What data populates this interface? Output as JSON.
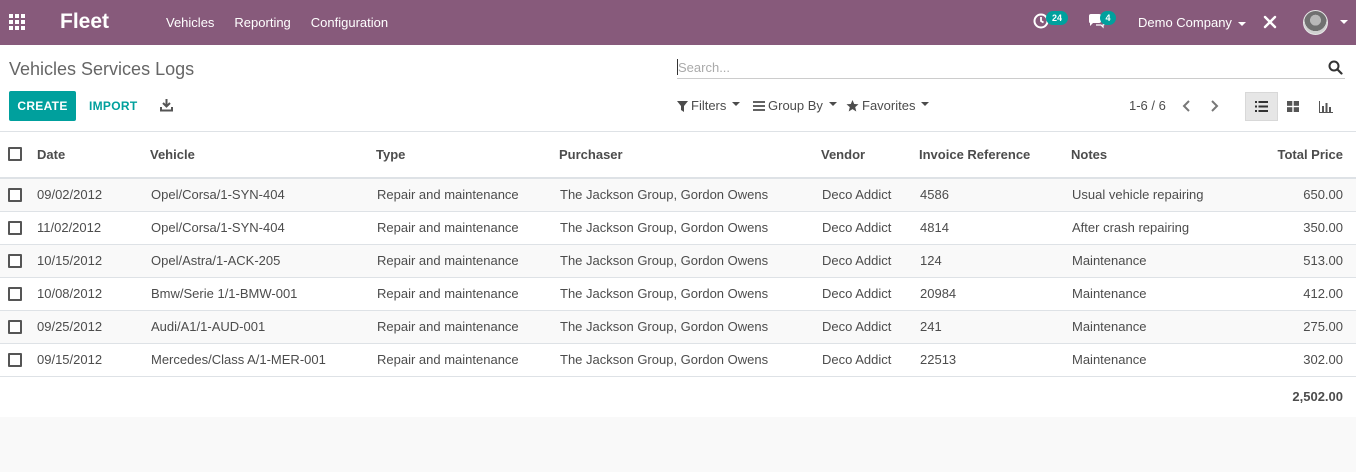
{
  "navbar": {
    "brand": "Fleet",
    "menu": [
      "Vehicles",
      "Reporting",
      "Configuration"
    ],
    "activity_count": "24",
    "chat_count": "4",
    "company": "Demo Company"
  },
  "control": {
    "title": "Vehicles Services Logs",
    "search_placeholder": "Search...",
    "create_label": "CREATE",
    "import_label": "IMPORT",
    "filters_label": "Filters",
    "groupby_label": "Group By",
    "favorites_label": "Favorites",
    "pager": "1-6 / 6"
  },
  "colors": {
    "navbar": "#875a7b",
    "accent": "#00a09d"
  },
  "table": {
    "headers": [
      "Date",
      "Vehicle",
      "Type",
      "Purchaser",
      "Vendor",
      "Invoice Reference",
      "Notes",
      "Total Price"
    ],
    "rows": [
      {
        "date": "09/02/2012",
        "vehicle": "Opel/Corsa/1-SYN-404",
        "type": "Repair and maintenance",
        "purchaser": "The Jackson Group, Gordon Owens",
        "vendor": "Deco Addict",
        "invoice": "4586",
        "notes": "Usual vehicle repairing",
        "total": "650.00"
      },
      {
        "date": "11/02/2012",
        "vehicle": "Opel/Corsa/1-SYN-404",
        "type": "Repair and maintenance",
        "purchaser": "The Jackson Group, Gordon Owens",
        "vendor": "Deco Addict",
        "invoice": "4814",
        "notes": "After crash repairing",
        "total": "350.00"
      },
      {
        "date": "10/15/2012",
        "vehicle": "Opel/Astra/1-ACK-205",
        "type": "Repair and maintenance",
        "purchaser": "The Jackson Group, Gordon Owens",
        "vendor": "Deco Addict",
        "invoice": "124",
        "notes": "Maintenance",
        "total": "513.00"
      },
      {
        "date": "10/08/2012",
        "vehicle": "Bmw/Serie 1/1-BMW-001",
        "type": "Repair and maintenance",
        "purchaser": "The Jackson Group, Gordon Owens",
        "vendor": "Deco Addict",
        "invoice": "20984",
        "notes": "Maintenance",
        "total": "412.00"
      },
      {
        "date": "09/25/2012",
        "vehicle": "Audi/A1/1-AUD-001",
        "type": "Repair and maintenance",
        "purchaser": "The Jackson Group, Gordon Owens",
        "vendor": "Deco Addict",
        "invoice": "241",
        "notes": "Maintenance",
        "total": "275.00"
      },
      {
        "date": "09/15/2012",
        "vehicle": "Mercedes/Class A/1-MER-001",
        "type": "Repair and maintenance",
        "purchaser": "The Jackson Group, Gordon Owens",
        "vendor": "Deco Addict",
        "invoice": "22513",
        "notes": "Maintenance",
        "total": "302.00"
      }
    ],
    "grand_total": "2,502.00"
  }
}
